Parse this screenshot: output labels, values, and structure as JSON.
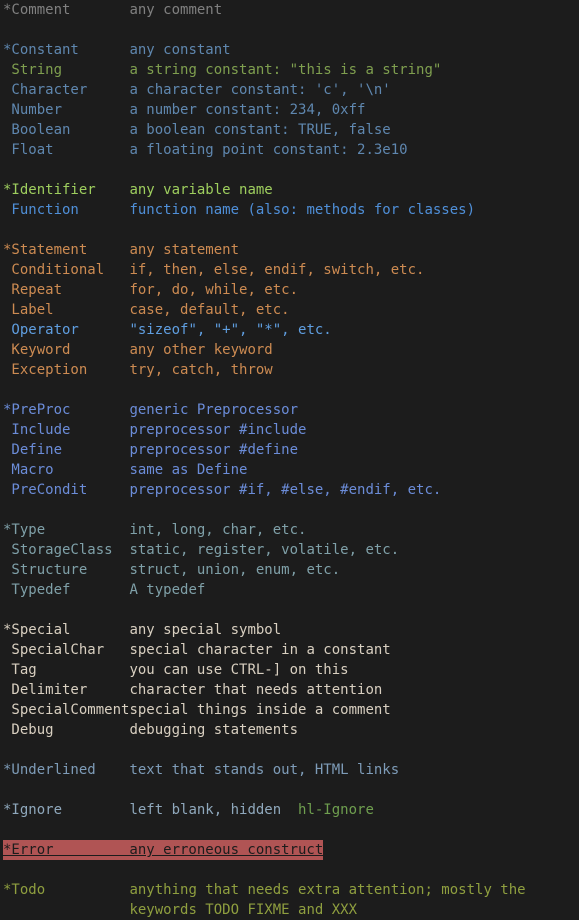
{
  "terminal": {
    "window_title": "vim :highlight groups reference",
    "background_color": "#1c1c1c",
    "font_size_px": 14,
    "line_height_px": 20,
    "name_column_width_chars": 15,
    "palette": {
      "comment": "#808080",
      "constant": "#5f87af",
      "string": "#7f9f4f",
      "identifier": "#9ece5e",
      "function": "#4f8fd8",
      "statement": "#cd8b52",
      "operator": "#5f9ee0",
      "preproc": "#6b8cd8",
      "type": "#7fa0a8",
      "special": "#d8cfc0",
      "underlined": "#7e9cb8",
      "ignore_label": "#b8c8d8",
      "ignore_text": "#8fa8bc",
      "hl_ignore": "#6f9f4f",
      "error_bg": "#b05454",
      "error_fg": "#1c1c1c",
      "todo": "#8f9f3f"
    },
    "groups": [
      {
        "id": "comment",
        "lines": [
          {
            "name": "*Comment",
            "desc": "any comment",
            "color_key": "comment",
            "top_level": true
          }
        ]
      },
      {
        "id": "constant",
        "lines": [
          {
            "name": "*Constant",
            "desc": "any constant",
            "color_key": "constant",
            "top_level": true
          },
          {
            "name": " String",
            "desc": "a string constant: \"this is a string\"",
            "color_key": "string",
            "top_level": false
          },
          {
            "name": " Character",
            "desc": "a character constant: 'c', '\\n'",
            "color_key": "constant",
            "top_level": false
          },
          {
            "name": " Number",
            "desc": "a number constant: 234, 0xff",
            "color_key": "constant",
            "top_level": false
          },
          {
            "name": " Boolean",
            "desc": "a boolean constant: TRUE, false",
            "color_key": "constant",
            "top_level": false
          },
          {
            "name": " Float",
            "desc": "a floating point constant: 2.3e10",
            "color_key": "constant",
            "top_level": false
          }
        ]
      },
      {
        "id": "identifier",
        "lines": [
          {
            "name": "*Identifier",
            "desc": "any variable name",
            "color_key": "identifier",
            "top_level": true
          },
          {
            "name": " Function",
            "desc": "function name (also: methods for classes)",
            "color_key": "function",
            "top_level": false
          }
        ]
      },
      {
        "id": "statement",
        "lines": [
          {
            "name": "*Statement",
            "desc": "any statement",
            "color_key": "statement",
            "top_level": true
          },
          {
            "name": " Conditional",
            "desc": "if, then, else, endif, switch, etc.",
            "color_key": "statement",
            "top_level": false
          },
          {
            "name": " Repeat",
            "desc": "for, do, while, etc.",
            "color_key": "statement",
            "top_level": false
          },
          {
            "name": " Label",
            "desc": "case, default, etc.",
            "color_key": "statement",
            "top_level": false
          },
          {
            "name": " Operator",
            "desc": "\"sizeof\", \"+\", \"*\", etc.",
            "color_key": "operator",
            "top_level": false
          },
          {
            "name": " Keyword",
            "desc": "any other keyword",
            "color_key": "statement",
            "top_level": false
          },
          {
            "name": " Exception",
            "desc": "try, catch, throw",
            "color_key": "statement",
            "top_level": false
          }
        ]
      },
      {
        "id": "preproc",
        "lines": [
          {
            "name": "*PreProc",
            "desc": "generic Preprocessor",
            "color_key": "preproc",
            "top_level": true
          },
          {
            "name": " Include",
            "desc": "preprocessor #include",
            "color_key": "preproc",
            "top_level": false
          },
          {
            "name": " Define",
            "desc": "preprocessor #define",
            "color_key": "preproc",
            "top_level": false
          },
          {
            "name": " Macro",
            "desc": "same as Define",
            "color_key": "preproc",
            "top_level": false
          },
          {
            "name": " PreCondit",
            "desc": "preprocessor #if, #else, #endif, etc.",
            "color_key": "preproc",
            "top_level": false
          }
        ]
      },
      {
        "id": "type",
        "lines": [
          {
            "name": "*Type",
            "desc": "int, long, char, etc.",
            "color_key": "type",
            "top_level": true
          },
          {
            "name": " StorageClass",
            "desc": "static, register, volatile, etc.",
            "color_key": "type",
            "top_level": false
          },
          {
            "name": " Structure",
            "desc": "struct, union, enum, etc.",
            "color_key": "type",
            "top_level": false
          },
          {
            "name": " Typedef",
            "desc": "A typedef",
            "color_key": "type",
            "top_level": false
          }
        ]
      },
      {
        "id": "special",
        "lines": [
          {
            "name": "*Special",
            "desc": "any special symbol",
            "color_key": "special",
            "top_level": true
          },
          {
            "name": " SpecialChar",
            "desc": "special character in a constant",
            "color_key": "special",
            "top_level": false
          },
          {
            "name": " Tag",
            "desc": "you can use CTRL-] on this",
            "color_key": "special",
            "top_level": false
          },
          {
            "name": " Delimiter",
            "desc": "character that needs attention",
            "color_key": "special",
            "top_level": false
          },
          {
            "name": " SpecialComment",
            "desc": "special things inside a comment",
            "color_key": "special",
            "top_level": false
          },
          {
            "name": " Debug",
            "desc": "debugging statements",
            "color_key": "special",
            "top_level": false
          }
        ]
      },
      {
        "id": "underlined",
        "lines": [
          {
            "name": "*Underlined",
            "desc": "text that stands out, HTML links",
            "color_key": "underlined",
            "top_level": true
          }
        ]
      },
      {
        "id": "ignore",
        "lines": [
          {
            "name": "*Ignore",
            "desc": "left blank, hidden",
            "extra": "hl-Ignore",
            "color_key": "ignore_text",
            "extra_color_key": "hl_ignore",
            "top_level": true
          }
        ]
      },
      {
        "id": "error",
        "lines": [
          {
            "name": "*Error",
            "desc": "any erroneous construct",
            "color_key": "error_fg",
            "highlighted": true,
            "top_level": true
          }
        ]
      },
      {
        "id": "todo",
        "lines": [
          {
            "name": "*Todo",
            "desc": "anything that needs extra attention; mostly the",
            "color_key": "todo",
            "top_level": true
          },
          {
            "name": "",
            "desc": "keywords TODO FIXME and XXX",
            "color_key": "todo",
            "top_level": false
          }
        ]
      }
    ]
  }
}
